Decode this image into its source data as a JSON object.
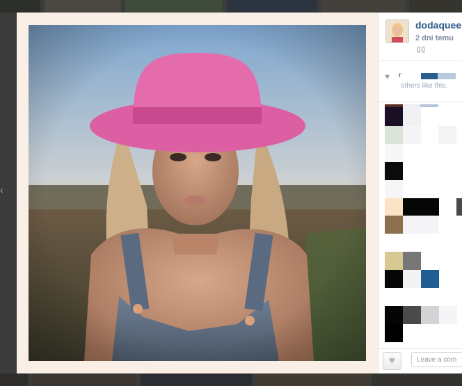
{
  "post": {
    "username": "dodaquee",
    "time_ago": "2 dni temu",
    "caption_glyphs": "▯▯",
    "photo_alt": "Photo"
  },
  "likes": {
    "first_liker": "r",
    "others_text": "others like this."
  },
  "footer": {
    "comment_placeholder": "Leave a com",
    "like_icon": "heart-icon"
  },
  "colors": {
    "username": "#2c5a85",
    "accent_bar": "#285d8e"
  }
}
